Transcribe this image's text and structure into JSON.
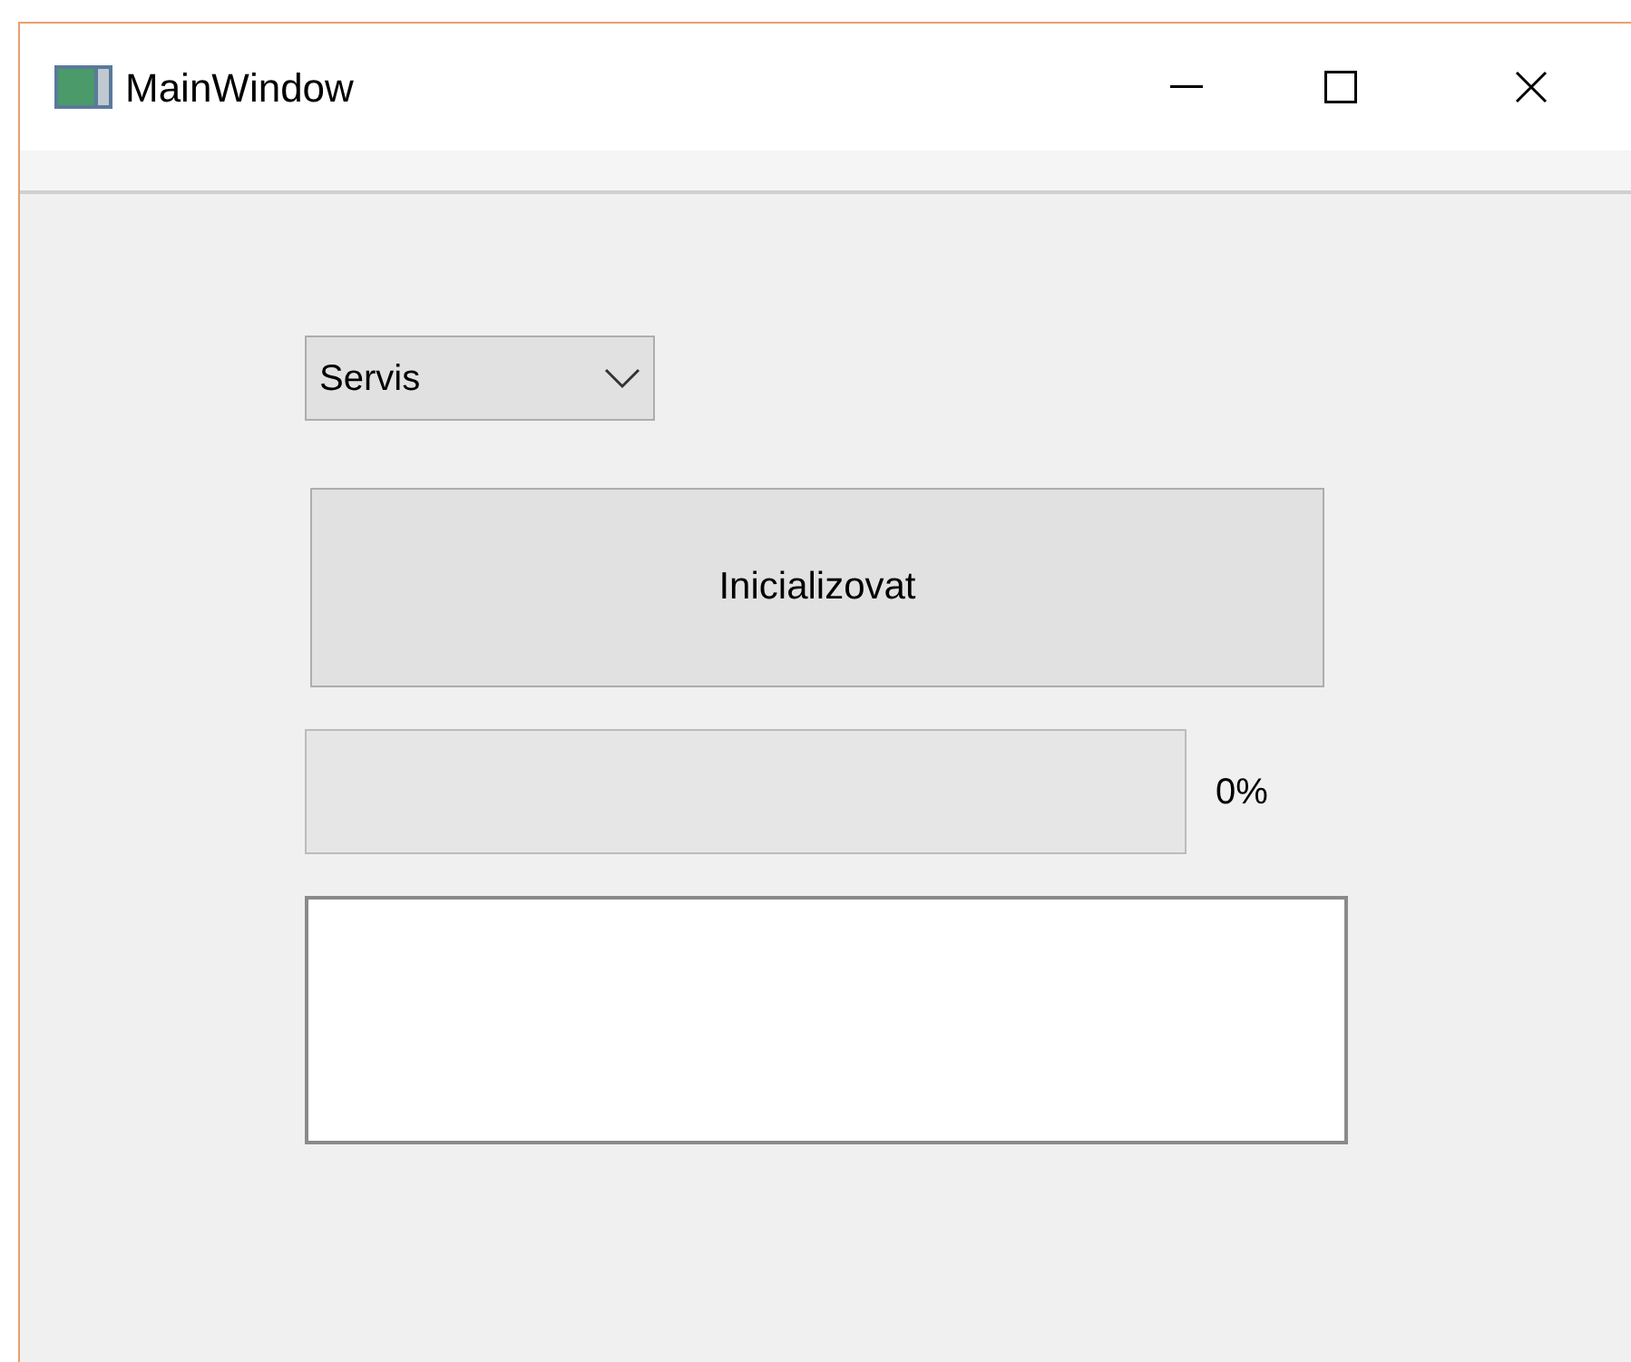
{
  "window": {
    "title": "MainWindow"
  },
  "combo": {
    "value": "Servis"
  },
  "button": {
    "label": "Inicializovat"
  },
  "progress": {
    "level": 0,
    "reading": "0%"
  }
}
